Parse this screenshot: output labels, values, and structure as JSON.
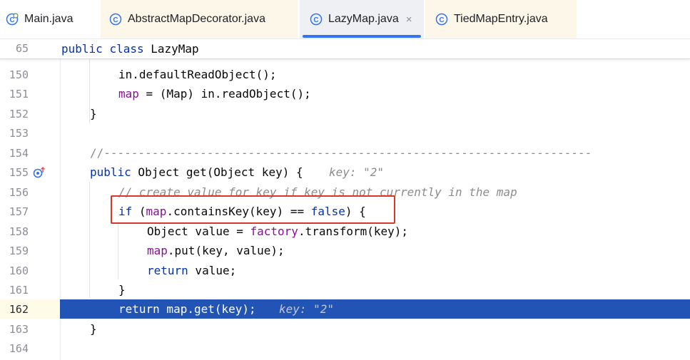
{
  "tabs": [
    {
      "label": "Main.java",
      "icon": "java-class-icon",
      "tinted": false,
      "active": false
    },
    {
      "label": "AbstractMapDecorator.java",
      "icon": "java-class-icon",
      "tinted": true,
      "active": false
    },
    {
      "label": "LazyMap.java",
      "icon": "java-class-icon",
      "tinted": false,
      "active": true,
      "close": "×"
    },
    {
      "label": "TiedMapEntry.java",
      "icon": "java-class-icon",
      "tinted": true,
      "active": false
    }
  ],
  "sticky_header": {
    "line_number": "65",
    "kw1": "public",
    "kw2": "class",
    "name": "LazyMap"
  },
  "lines": {
    "n150": "150",
    "n151": "151",
    "n152": "152",
    "n153": "153",
    "n154": "154",
    "n155": "155",
    "n156": "156",
    "n157": "157",
    "n158": "158",
    "n159": "159",
    "n160": "160",
    "n161": "161",
    "n162": "162",
    "n163": "163",
    "n164": "164",
    "l150": "in.defaultReadObject();",
    "l151_field": "map",
    "l151_rest": " = (Map) in.readObject();",
    "l152": "}",
    "l154": "//-----------------------------------------------------------------------",
    "l155_kw": "public",
    "l155_rest": " Object get(Object key) {",
    "l155_hint": "key: \"2\"",
    "l156": "// create value for key if key is not currently in the map",
    "l157_if": "if",
    "l157_a": " (",
    "l157_field": "map",
    "l157_b": ".containsKey(key) == ",
    "l157_false": "false",
    "l157_c": ") {",
    "l158_a": "Object value = ",
    "l158_field": "factory",
    "l158_b": ".transform(key);",
    "l159_field": "map",
    "l159_b": ".put(key, value);",
    "l160_kw": "return",
    "l160_b": " value;",
    "l161": "}",
    "l162": "return map.get(key);",
    "l162_hint": "key: \"2\"",
    "l163": "}"
  },
  "colors": {
    "keyword": "#0033b3",
    "field": "#871094",
    "comment": "#8c8c8c",
    "execution_line": "#2154b5",
    "annotation_box": "#d9372a",
    "tab_accent": "#3574f0"
  }
}
